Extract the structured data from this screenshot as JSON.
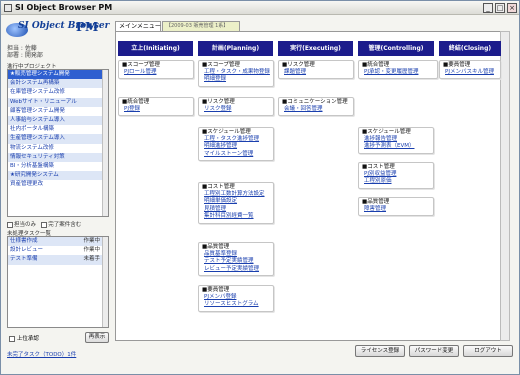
{
  "window": {
    "title": "SI Object Browser PM"
  },
  "logo": {
    "text": "SI Object Browser",
    "suffix": "PM"
  },
  "user": {
    "line1": "担当 : 佐藤",
    "line2": "部署 : 開発部"
  },
  "projects": {
    "label": "進行中プロジェクト",
    "items": [
      "★販売管理システム開発",
      "会計システム再構築",
      "在庫管理システム改修",
      "Webサイト・リニューアル",
      "顧客管理システム開発",
      "人事給与システム導入",
      "社内ポータル構築",
      "生産管理システム導入",
      "物流システム改修",
      "情報セキュリティ対策",
      "BI・分析基盤構築",
      "★研究開発システム",
      "資産管理更改"
    ]
  },
  "checks": {
    "a": "担当のみ",
    "b": "完了案件含む"
  },
  "todo": {
    "label": "未処理タスク一覧",
    "items": [
      {
        "name": "仕様書作成",
        "status": "作業中"
      },
      {
        "name": "設計レビュー",
        "status": "作業中"
      },
      {
        "name": "テスト準備",
        "status": "未着手"
      }
    ]
  },
  "bottom": {
    "check_label": "上位承認",
    "redisplay_button": "再表示"
  },
  "footer": {
    "link": "未完了タスク（TODO）1件"
  },
  "tabs": {
    "main": "メインメニュー",
    "project": "【2009-03 販売管理 1系】"
  },
  "phases": {
    "initiating": "立上(Initiating)",
    "planning": "計画(Planning)",
    "executing": "実行(Executing)",
    "controlling": "管理(Controlling)",
    "closing": "終結(Closing)"
  },
  "boxes": {
    "init_scope": {
      "title": "■スコープ管理",
      "links": [
        "PJロール管理"
      ]
    },
    "init_integration": {
      "title": "■統合管理",
      "links": [
        "PJ登録"
      ]
    },
    "plan_scope": {
      "title": "■スコープ管理",
      "links": [
        "工程・タスク・成果物登録",
        "明細登録"
      ]
    },
    "plan_risk": {
      "title": "■リスク管理",
      "links": [
        "リスク登録"
      ]
    },
    "plan_schedule": {
      "title": "■スケジュール管理",
      "links": [
        "工程・タスク進捗管理",
        "明細進捗管理",
        "マイルストーン管理"
      ]
    },
    "plan_cost": {
      "title": "■コスト管理",
      "links": [
        "工程別工数計算方法設定",
        "明細単価設定",
        "見積管理",
        "集計科目別経費一覧"
      ]
    },
    "plan_quality": {
      "title": "■品質管理",
      "links": [
        "品質基準登録",
        "テスト予定実績管理",
        "レビュー予定実績管理"
      ]
    },
    "plan_hr": {
      "title": "■要員管理",
      "links": [
        "PJメンバ登録",
        "リソースヒストグラム"
      ]
    },
    "exec_risk": {
      "title": "■リスク管理",
      "links": [
        "課題管理"
      ]
    },
    "exec_comm": {
      "title": "■コミュニケーション管理",
      "links": [
        "会議・回答管理"
      ]
    },
    "ctrl_integration": {
      "title": "■統合管理",
      "links": [
        "PJ承認・変更履歴管理"
      ]
    },
    "ctrl_schedule": {
      "title": "■スケジュール管理",
      "links": [
        "進捗報告管理",
        "進捗予測表（EVM）"
      ]
    },
    "ctrl_cost": {
      "title": "■コスト管理",
      "links": [
        "PJ別収益管理",
        "工程別原価"
      ]
    },
    "ctrl_quality": {
      "title": "■品質管理",
      "links": [
        "障害管理"
      ]
    },
    "close_hr": {
      "title": "■要員管理",
      "links": [
        "PJメンバスキル管理"
      ]
    }
  },
  "buttons": {
    "license": "ライセンス登録",
    "password": "パスワード変更",
    "logout": "ログアウト"
  }
}
